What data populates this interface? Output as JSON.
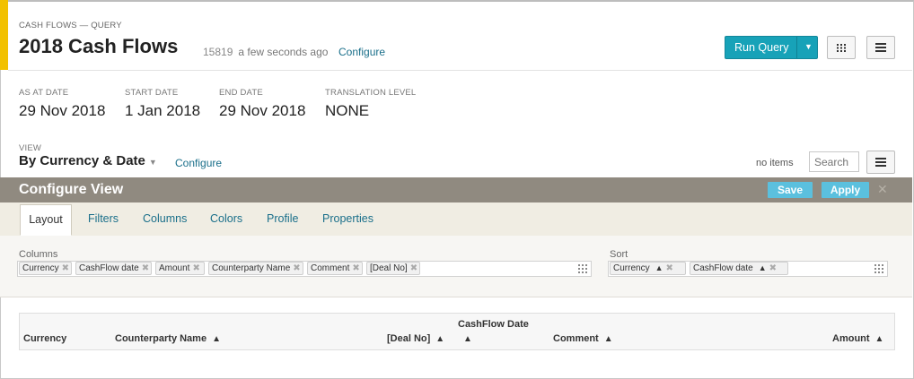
{
  "header": {
    "breadcrumb": "CASH FLOWS — QUERY",
    "title": "2018 Cash Flows",
    "query_id": "15819",
    "updated": "a few seconds ago",
    "configure": "Configure",
    "run_label": "Run Query",
    "accent_color": "#f2c100",
    "run_color": "#17a2b8"
  },
  "params": [
    {
      "label": "AS AT DATE",
      "value": "29 Nov 2018"
    },
    {
      "label": "START DATE",
      "value": "1 Jan 2018"
    },
    {
      "label": "END DATE",
      "value": "29 Nov 2018"
    },
    {
      "label": "TRANSLATION LEVEL",
      "value": "NONE"
    }
  ],
  "view": {
    "label": "VIEW",
    "name": "By Currency & Date",
    "configure": "Configure",
    "count": "no items",
    "search_placeholder": "Search"
  },
  "configure_view": {
    "title": "Configure View",
    "save": "Save",
    "apply": "Apply",
    "close": "✕",
    "tabs": [
      "Layout",
      "Filters",
      "Columns",
      "Colors",
      "Profile",
      "Properties"
    ],
    "active_tab": "Layout",
    "columns_label": "Columns",
    "columns": [
      "Currency",
      "CashFlow date",
      "Amount",
      "Counterparty Name",
      "Comment",
      "[Deal No]"
    ],
    "sort_label": "Sort",
    "sort": [
      {
        "name": "Currency",
        "direction": "ascending"
      },
      {
        "name": "CashFlow date",
        "direction": "ascending"
      }
    ]
  },
  "table": {
    "headers": [
      "Currency",
      "Counterparty Name",
      "[Deal No]",
      "CashFlow Date",
      "Comment",
      "Amount"
    ]
  }
}
